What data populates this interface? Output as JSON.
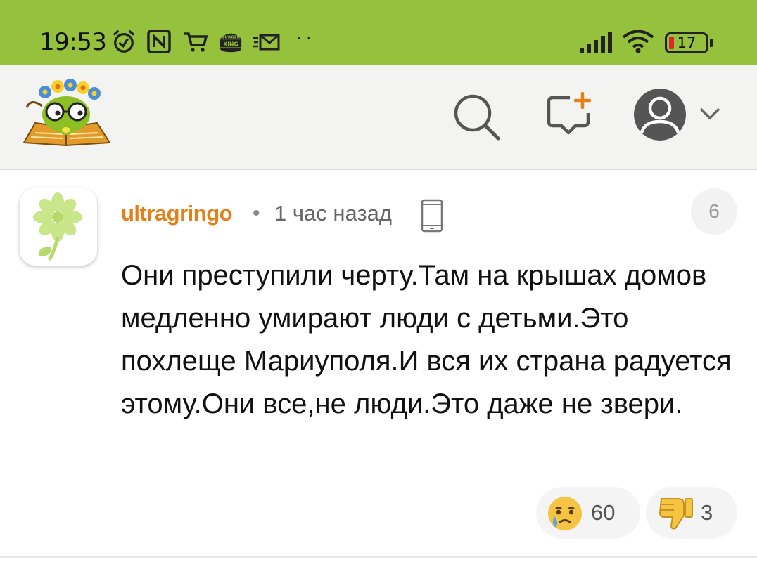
{
  "status_bar": {
    "time": "19:53",
    "battery_level": "17",
    "icons": [
      "alarm-icon",
      "nfc-icon",
      "cart-icon",
      "burger-king-icon",
      "mail-icon",
      "more-dots-icon",
      "signal-icon",
      "wifi-icon",
      "battery-icon"
    ],
    "dots": "··",
    "burger_king_logo_text": "BURGER KING"
  },
  "header": {
    "icons": [
      "site-logo",
      "search-icon",
      "new-comment-icon",
      "user-avatar-icon",
      "chevron-down-icon"
    ]
  },
  "comment": {
    "author": "ultragringo",
    "separator": "•",
    "time": "1 час назад",
    "device_icon": "phone-icon",
    "rating": "6",
    "text": "Они преступили черту.Там на крышах домов медленно умирают люди с детьми.Это похлеще Мариуполя.И вся их страна радуется этому.Они все,не люди.Это даже не звери.",
    "reactions": [
      {
        "icon": "crying-face-icon",
        "count": "60"
      },
      {
        "icon": "thumbs-down-icon",
        "count": "3"
      }
    ]
  },
  "colors": {
    "status_bar_bg": "#95c13d",
    "header_bg": "#f3f3f1",
    "author": "#e3801a",
    "battery_low": "#e0262b"
  }
}
